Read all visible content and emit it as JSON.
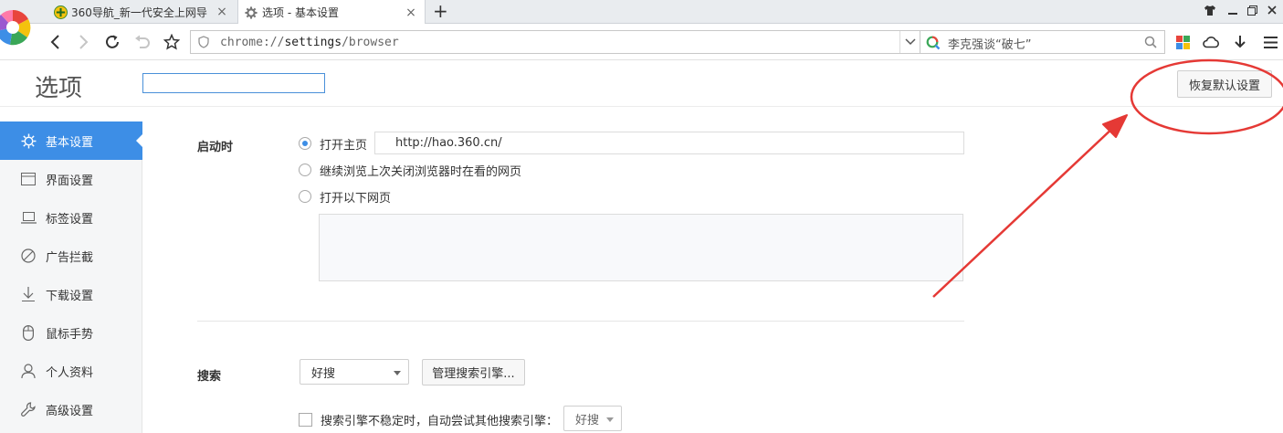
{
  "tabs": [
    {
      "title": "360导航_新一代安全上网导",
      "active": false
    },
    {
      "title": "选项 - 基本设置",
      "active": true
    }
  ],
  "toolbar": {
    "url_prefix": "chrome://",
    "url_host": "settings",
    "url_path": "/browser",
    "search_text": "李克强谈“破七”"
  },
  "page": {
    "title": "选项",
    "search_value": "",
    "reset_label": "恢复默认设置"
  },
  "sidebar": {
    "items": [
      {
        "label": "基本设置",
        "icon": "gear-icon",
        "active": true
      },
      {
        "label": "界面设置",
        "icon": "window-icon",
        "active": false
      },
      {
        "label": "标签设置",
        "icon": "laptop-icon",
        "active": false
      },
      {
        "label": "广告拦截",
        "icon": "block-icon",
        "active": false
      },
      {
        "label": "下载设置",
        "icon": "download-icon",
        "active": false
      },
      {
        "label": "鼠标手势",
        "icon": "mouse-icon",
        "active": false
      },
      {
        "label": "个人资料",
        "icon": "user-icon",
        "active": false
      },
      {
        "label": "高级设置",
        "icon": "wrench-icon",
        "active": false
      }
    ]
  },
  "startup": {
    "label": "启动时",
    "options": [
      {
        "label": "打开主页",
        "checked": true
      },
      {
        "label": "继续浏览上次关闭浏览器时在看的网页",
        "checked": false
      },
      {
        "label": "打开以下网页",
        "checked": false
      }
    ],
    "homepage": "http://hao.360.cn/"
  },
  "search": {
    "label": "搜索",
    "engine": "好搜",
    "manage_label": "管理搜索引擎...",
    "fallback_label": "搜索引擎不稳定时，自动尝试其他搜索引擎：",
    "fallback_engine": "好搜",
    "fallback_checked": false
  },
  "colors": {
    "accent": "#3d8ee6",
    "annotation": "#e53935"
  }
}
